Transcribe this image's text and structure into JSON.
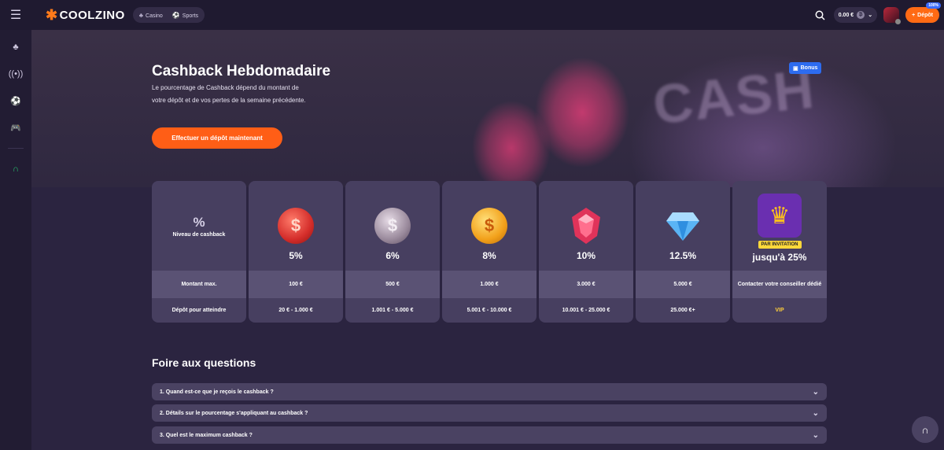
{
  "topbar": {
    "logo": "COOLZINO",
    "nav": [
      {
        "label": "Casino",
        "icon": "cherry-icon"
      },
      {
        "label": "Sports",
        "icon": "ball-icon"
      }
    ],
    "balance": "0.00 €",
    "deposit_label": "Dépôt",
    "deposit_badge": "100%"
  },
  "sidebar": {
    "icons": [
      "cherry-icon",
      "live-icon",
      "football-icon",
      "gamepad-icon",
      "headset-icon"
    ]
  },
  "hero": {
    "title": "Cashback Hebdomadaire",
    "description": "Le pourcentage de Cashback dépend du montant de votre dépôt et de vos pertes de la semaine précédente.",
    "cta": "Effectuer un dépôt maintenant",
    "bonus_label": "Bonus",
    "deco_text": "CASH"
  },
  "table": {
    "label_symbol": "%",
    "label_title": "Niveau de cashback",
    "row_max": "Montant max.",
    "row_range": "Dépôt pour atteindre",
    "tiers": [
      {
        "pct": "5%",
        "max": "100 €",
        "range": "20 € - 1.000 €",
        "icon": "red-coin-icon",
        "color": "#e0403a"
      },
      {
        "pct": "6%",
        "max": "500 €",
        "range": "1.001 € - 5.000 €",
        "icon": "silver-coin-icon",
        "color": "#a99aa8"
      },
      {
        "pct": "8%",
        "max": "1.000 €",
        "range": "5.001 € - 10.000 €",
        "icon": "gold-coin-icon",
        "color": "#f2a81e"
      },
      {
        "pct": "10%",
        "max": "3.000 €",
        "range": "10.001 € - 25.000 €",
        "icon": "ruby-icon",
        "color": "#e0335a"
      },
      {
        "pct": "12.5%",
        "max": "5.000 €",
        "range": "25.000 €+",
        "icon": "diamond-icon",
        "color": "#6cc3ff"
      },
      {
        "pct": "jusqu'à 25%",
        "max": "Contacter votre conseiller dédié",
        "range": "VIP",
        "icon": "crown-icon",
        "invite": "PAR INVITATION"
      }
    ]
  },
  "faq": {
    "title": "Foire aux questions",
    "items": [
      "1. Quand est-ce que je reçois le cashback ?",
      "2. Détails sur le pourcentage s'appliquant au cashback ?",
      "3. Quel est le maximum cashback ?"
    ]
  }
}
